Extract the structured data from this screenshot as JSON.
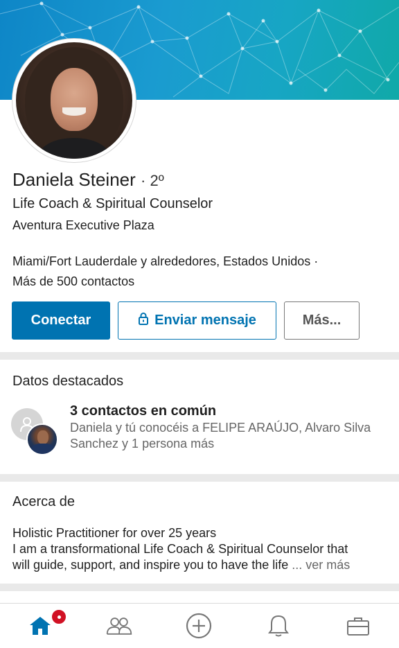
{
  "profile": {
    "name": "Daniela Steiner",
    "degree": "· 2º",
    "headline": "Life Coach & Spiritual Counselor",
    "company": "Aventura Executive Plaza",
    "location": "Miami/Fort Lauderdale y alrededores, Estados Unidos ·",
    "connections": "Más de 500 contactos"
  },
  "actions": {
    "connect_label": "Conectar",
    "message_label": "Enviar mensaje",
    "more_label": "Más..."
  },
  "highlights": {
    "title": "Datos destacados",
    "shared_title": "3 contactos en común",
    "shared_desc": "Daniela y tú conocéis a FELIPE ARAÚJO, Alvaro Silva Sanchez y 1 persona más"
  },
  "about": {
    "title": "Acerca de",
    "line1": "Holistic Practitioner for over 25 years",
    "line2": "I am a transformational Life Coach & Spiritual Counselor that",
    "line3": "will guide, support, and inspire you to have the life",
    "see_more": "... ver más"
  },
  "nav": {
    "items": [
      "home-icon",
      "network-icon",
      "post-icon",
      "notifications-icon",
      "jobs-icon"
    ],
    "active": "home-icon",
    "active_color": "#0073b1",
    "inactive_color": "#777777",
    "badge_color": "#d11124"
  },
  "colors": {
    "brand": "#0073b1",
    "banner_start": "#0e86c7",
    "banner_end": "#10a9a8"
  }
}
